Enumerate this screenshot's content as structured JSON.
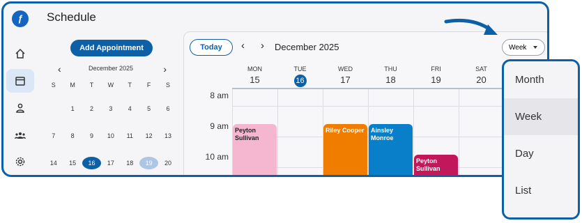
{
  "app": {
    "title": "Schedule",
    "logo_text": "ƒ"
  },
  "rail": {
    "items": [
      "home-icon",
      "calendar-icon",
      "person-icon",
      "group-icon",
      "gear-icon"
    ]
  },
  "add_button": "Add Appointment",
  "mini_calendar": {
    "month": "December 2025",
    "prev": "‹",
    "next": "›",
    "dow": [
      "S",
      "M",
      "T",
      "W",
      "T",
      "F",
      "S"
    ],
    "weeks": [
      [
        "",
        "1",
        "2",
        "3",
        "4",
        "5",
        "6"
      ],
      [
        "7",
        "8",
        "9",
        "10",
        "11",
        "12",
        "13"
      ],
      [
        "14",
        "15",
        "16",
        "17",
        "18",
        "19",
        "20"
      ]
    ]
  },
  "toolbar": {
    "today": "Today",
    "prev": "‹",
    "next": "›",
    "range": "December 2025",
    "view": "Week"
  },
  "days": [
    {
      "dow": "MON",
      "num": "15"
    },
    {
      "dow": "TUE",
      "num": "16"
    },
    {
      "dow": "WED",
      "num": "17"
    },
    {
      "dow": "THU",
      "num": "18"
    },
    {
      "dow": "FRI",
      "num": "19"
    },
    {
      "dow": "SAT",
      "num": "20"
    }
  ],
  "times": [
    "8 am",
    "9 am",
    "10 am"
  ],
  "events": [
    {
      "name": "Peyton Sullivan",
      "day": "MON",
      "color": "#f4b7cf",
      "text_color": "#222222"
    },
    {
      "name": "Riley Cooper",
      "day": "WED",
      "color": "#f07d00",
      "text_color": "#ffffff"
    },
    {
      "name": "Ainsley Monroe",
      "day": "THU",
      "color": "#0a7fc9",
      "text_color": "#ffffff"
    },
    {
      "name": "Peyton Sullivan",
      "day": "FRI",
      "color": "#c2185b",
      "text_color": "#ffffff"
    }
  ],
  "view_menu": {
    "options": [
      "Month",
      "Week",
      "Day",
      "List"
    ],
    "selected": "Week"
  },
  "colors": {
    "accent": "#0d5fa6",
    "today": "#0d5fa6",
    "selected_day": "#aec6e6"
  }
}
